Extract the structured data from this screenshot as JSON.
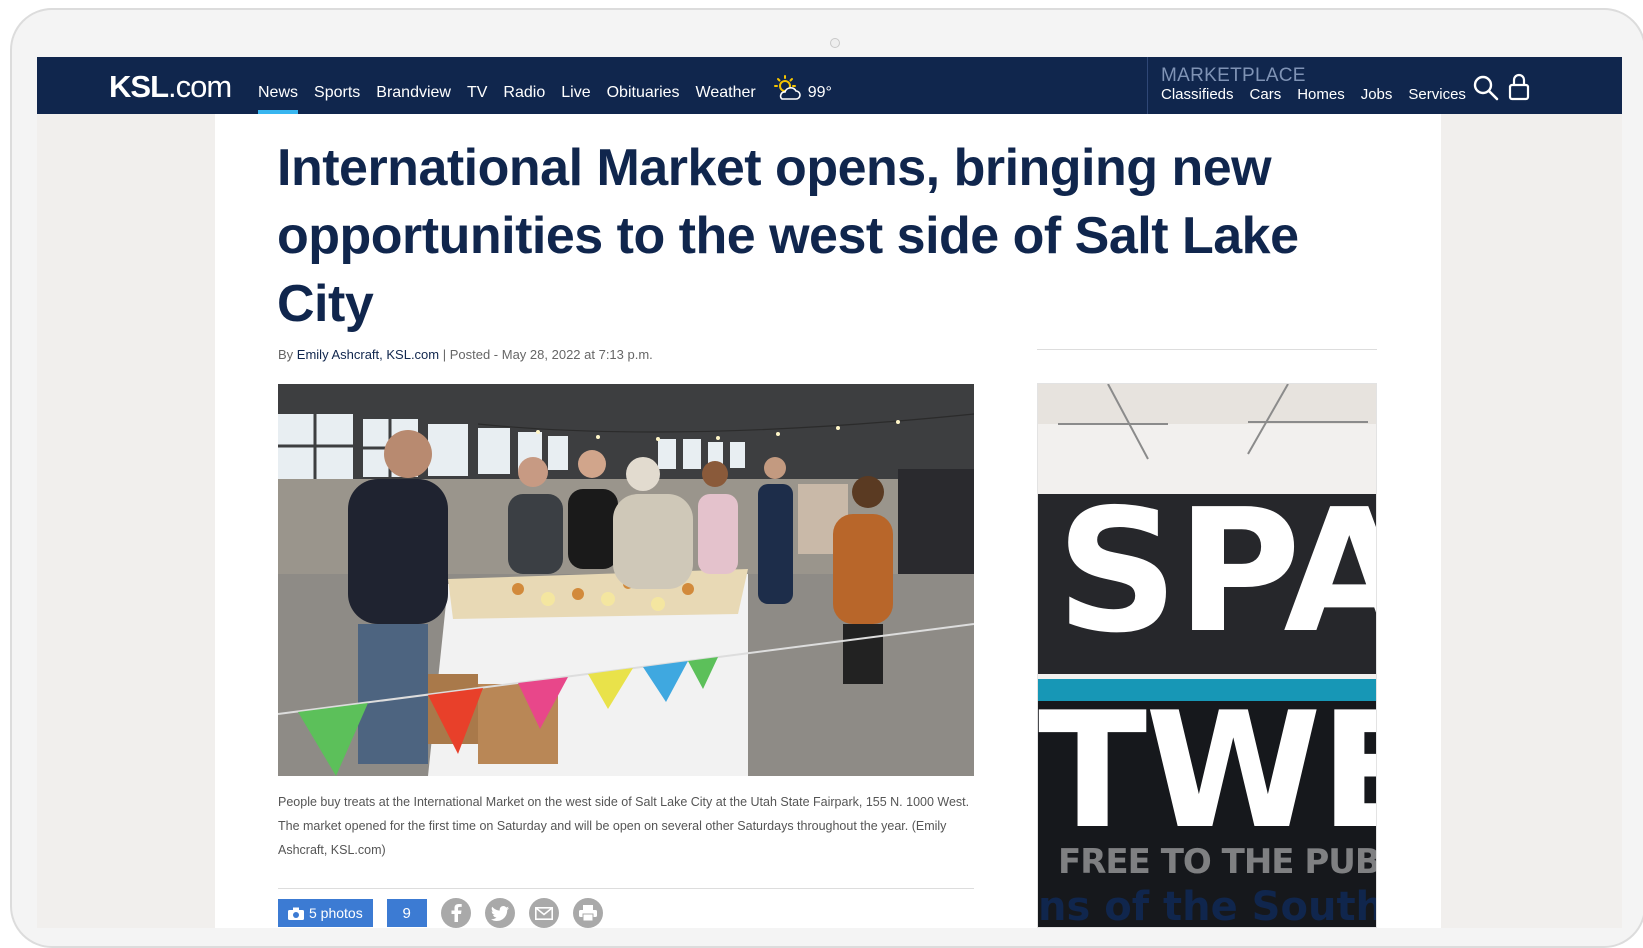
{
  "header": {
    "logo_main": "KSL",
    "logo_domain": ".com",
    "nav": [
      "News",
      "Sports",
      "Brandview",
      "TV",
      "Radio",
      "Live",
      "Obituaries",
      "Weather"
    ],
    "active_nav": "News",
    "temperature": "99°",
    "marketplace_title": "MARKETPLACE",
    "marketplace_links": [
      "Classifieds",
      "Cars",
      "Homes",
      "Jobs",
      "Services"
    ]
  },
  "article": {
    "headline": "International Market opens, bringing new opportunities to the west side of Salt Lake City",
    "by": "By ",
    "author": "Emily Ashcraft, KSL.com",
    "posted": " | Posted - May 28, 2022 at 7:13 p.m.",
    "caption": "People buy treats at the International Market on the west side of Salt Lake City at the Utah State Fairpark, 155 N. 1000 West. The market opened for the first time on Saturday and will be open on several other Saturdays throughout the year. (Emily Ashcraft, KSL.com)",
    "photos_label": "5 photos",
    "comment_count": "9"
  },
  "ad": {
    "line1": "SPAC",
    "line2": "TWE",
    "faded": "FREE TO THE PUBLIC",
    "footer": "ns of the South"
  },
  "colors": {
    "nav_bg": "#10264d",
    "accent": "#38b6f0",
    "button": "#3c7bd3",
    "headline": "#10264d"
  },
  "icons": [
    "weather-sun-cloud-icon",
    "search-icon",
    "user-lock-icon",
    "camera-icon",
    "facebook-icon",
    "twitter-icon",
    "email-icon",
    "print-icon"
  ]
}
